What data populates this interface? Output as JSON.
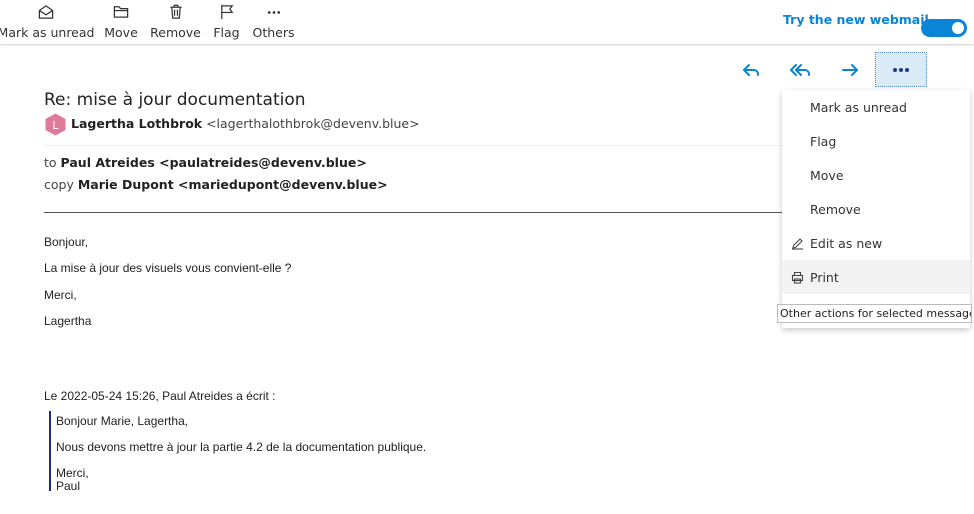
{
  "toolbar": {
    "items": [
      {
        "label": "Mark as unread",
        "icon": "envelope-open-icon"
      },
      {
        "label": "Move",
        "icon": "folder-icon"
      },
      {
        "label": "Remove",
        "icon": "trash-icon"
      },
      {
        "label": "Flag",
        "icon": "flag-icon"
      },
      {
        "label": "Others",
        "icon": "more-dots-icon"
      }
    ],
    "try_webmail": "Try the new webmail",
    "webmail_toggle_on": true
  },
  "message": {
    "subject": "Re: mise à jour documentation",
    "avatar_letter": "L",
    "avatar_color": "#e07a9b",
    "sender_name": "Lagertha Lothbrok",
    "sender_email": "<lagerthalothbrok@devenv.blue>",
    "to_label": "to",
    "to_value": "Paul Atreides <paulatreides@devenv.blue>",
    "copy_label": "copy",
    "copy_value": "Marie Dupont <mariedupont@devenv.blue>",
    "body": [
      "Bonjour,",
      "La mise à jour des visuels vous convient-elle ?",
      "Merci,",
      "Lagertha"
    ],
    "quote_intro": "Le 2022-05-24 15:26, Paul Atreides a écrit :",
    "quote": [
      "Bonjour Marie, Lagertha,",
      "Nous devons mettre à jour la partie 4.2 de la documentation publique.",
      "Merci,",
      "Paul"
    ]
  },
  "actions": {
    "icons": [
      "reply-icon",
      "reply-all-icon",
      "forward-icon",
      "more-actions-icon"
    ],
    "accent_color": "#0a84d6"
  },
  "menu": {
    "items": [
      {
        "label": "Mark as unread",
        "icon": ""
      },
      {
        "label": "Flag",
        "icon": ""
      },
      {
        "label": "Move",
        "icon": ""
      },
      {
        "label": "Remove",
        "icon": ""
      },
      {
        "label": "Edit as new",
        "icon": "pencil-icon"
      },
      {
        "label": "Print",
        "icon": "printer-icon"
      }
    ],
    "tooltip": "Other actions for selected messages"
  }
}
